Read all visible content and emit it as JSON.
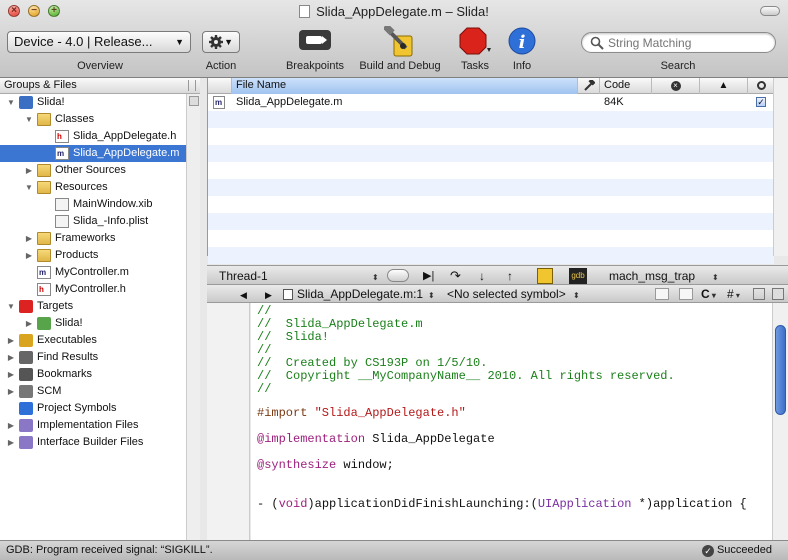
{
  "window": {
    "title": "Slida_AppDelegate.m – Slida!"
  },
  "toolbar": {
    "overview_value": "Device - 4.0 | Release...",
    "overview_label": "Overview",
    "action_label": "Action",
    "breakpoints_label": "Breakpoints",
    "build_debug_label": "Build and Debug",
    "tasks_label": "Tasks",
    "info_label": "Info",
    "search_placeholder": "String Matching",
    "search_label": "Search"
  },
  "sidebar": {
    "header": "Groups & Files",
    "items": [
      {
        "label": "Slida!",
        "depth": 0,
        "expanded": true,
        "icon": "project-icon"
      },
      {
        "label": "Classes",
        "depth": 1,
        "expanded": true,
        "icon": "folder-icon"
      },
      {
        "label": "Slida_AppDelegate.h",
        "depth": 2,
        "icon": "header-file-icon"
      },
      {
        "label": "Slida_AppDelegate.m",
        "depth": 2,
        "icon": "source-file-icon",
        "selected": true
      },
      {
        "label": "Other Sources",
        "depth": 1,
        "expanded": false,
        "icon": "folder-icon"
      },
      {
        "label": "Resources",
        "depth": 1,
        "expanded": true,
        "icon": "folder-icon"
      },
      {
        "label": "MainWindow.xib",
        "depth": 2,
        "icon": "xib-file-icon"
      },
      {
        "label": "Slida_-Info.plist",
        "depth": 2,
        "icon": "plist-file-icon"
      },
      {
        "label": "Frameworks",
        "depth": 1,
        "expanded": false,
        "icon": "folder-icon"
      },
      {
        "label": "Products",
        "depth": 1,
        "expanded": false,
        "icon": "folder-icon"
      },
      {
        "label": "MyController.m",
        "depth": 1,
        "icon": "source-file-icon"
      },
      {
        "label": "MyController.h",
        "depth": 1,
        "icon": "header-file-icon"
      },
      {
        "label": "Targets",
        "depth": 0,
        "expanded": true,
        "icon": "target-icon"
      },
      {
        "label": "Slida!",
        "depth": 1,
        "expanded": false,
        "icon": "app-target-icon"
      },
      {
        "label": "Executables",
        "depth": 0,
        "expanded": false,
        "icon": "executable-icon"
      },
      {
        "label": "Find Results",
        "depth": 0,
        "expanded": false,
        "icon": "magnifier-icon"
      },
      {
        "label": "Bookmarks",
        "depth": 0,
        "expanded": false,
        "icon": "bookmark-icon"
      },
      {
        "label": "SCM",
        "depth": 0,
        "expanded": false,
        "icon": "scm-icon"
      },
      {
        "label": "Project Symbols",
        "depth": 0,
        "icon": "symbols-icon"
      },
      {
        "label": "Implementation Files",
        "depth": 0,
        "expanded": false,
        "icon": "smart-group-icon"
      },
      {
        "label": "Interface Builder Files",
        "depth": 0,
        "expanded": false,
        "icon": "smart-group-icon"
      }
    ]
  },
  "file_list": {
    "columns": [
      "File Name",
      "Code"
    ],
    "rows": [
      {
        "name": "Slida_AppDelegate.m",
        "code": "84K",
        "checked": true
      }
    ]
  },
  "debug_bar": {
    "thread": "Thread-1",
    "frame": "mach_msg_trap"
  },
  "editor_nav": {
    "file": "Slida_AppDelegate.m:1",
    "symbol": "<No selected symbol>",
    "c_menu": "C",
    "hash_menu": "#"
  },
  "code": {
    "lines": [
      {
        "text": "//",
        "kind": "comment"
      },
      {
        "text": "//  Slida_AppDelegate.m",
        "kind": "comment"
      },
      {
        "text": "//  Slida!",
        "kind": "comment"
      },
      {
        "text": "//",
        "kind": "comment"
      },
      {
        "text": "//  Created by CS193P on 1/5/10.",
        "kind": "comment"
      },
      {
        "text": "//  Copyright __MyCompanyName__ 2010. All rights reserved.",
        "kind": "comment"
      },
      {
        "text": "//",
        "kind": "comment"
      },
      {
        "directive": "#import ",
        "string": "\"Slida_AppDelegate.h\""
      },
      {
        "keyword": "@implementation",
        "rest": " Slida_AppDelegate"
      },
      {
        "keyword": "@synthesize",
        "rest": " window;"
      },
      {
        "pre": "- (",
        "keyword": "void",
        "mid": ")applicationDidFinishLaunching:(",
        "type": "UIApplication",
        "rest": " *)application {"
      }
    ]
  },
  "status": {
    "message": "GDB: Program received signal:  “SIGKILL”.",
    "result": "Succeeded"
  }
}
